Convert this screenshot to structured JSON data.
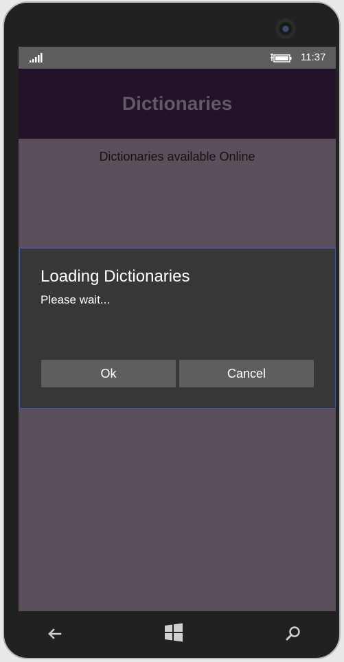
{
  "status_bar": {
    "time": "11:37",
    "signal_icon": "signal-strength-icon",
    "battery_icon": "battery-charging-icon"
  },
  "app": {
    "title": "Dictionaries",
    "subtitle": "Dictionaries available Online"
  },
  "dialog": {
    "title": "Loading Dictionaries",
    "message": "Please wait...",
    "ok_label": "Ok",
    "cancel_label": "Cancel"
  },
  "nav": {
    "back_icon": "back-arrow-icon",
    "start_icon": "windows-logo-icon",
    "search_icon": "search-icon"
  },
  "colors": {
    "page_bg": "#5a4f5b",
    "header_bg": "#24112a",
    "dialog_bg": "#373737",
    "dialog_border": "#3d59c9",
    "button_bg": "#5e5e5e"
  }
}
